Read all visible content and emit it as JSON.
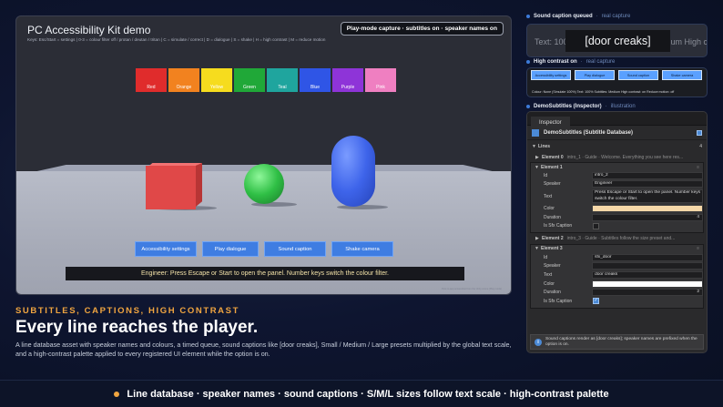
{
  "game": {
    "title": "PC Accessibility Kit demo",
    "keys_hint": "Keys: Esc/Start = settings  |  0-3 = colour filter off / protan / deutan / tritan  |  C = simulate / correct  |  D = dialogue  |  S = shake  |  H = high contrast  |  M = reduce motion",
    "badge": "Play-mode capture · subtitles on · speaker names on",
    "swatches": [
      {
        "label": "Red",
        "color": "#e02c2c"
      },
      {
        "label": "Orange",
        "color": "#f2821f"
      },
      {
        "label": "Yellow",
        "color": "#f6dc1e"
      },
      {
        "label": "Green",
        "color": "#20a838"
      },
      {
        "label": "Teal",
        "color": "#1fa59e"
      },
      {
        "label": "Blue",
        "color": "#2f55e6"
      },
      {
        "label": "Purple",
        "color": "#8e34d8"
      },
      {
        "label": "Pink",
        "color": "#ef7fc1"
      }
    ],
    "buttons": [
      "Accessibility settings",
      "Play dialogue",
      "Sound caption",
      "Shake camera"
    ],
    "subtitle": "Engineer: Press Escape or Start to open the panel. Number keys switch the colour filter.",
    "watermark": "Pure in-app screenshot from the Unity scene (Play mode)"
  },
  "copy": {
    "kicker": "SUBTITLES, CAPTIONS, HIGH CONTRAST",
    "headline": "Every line reaches the player.",
    "description": "A line database asset with speaker names and colours, a timed queue, sound captions like [door creaks], Small / Medium / Large presets multiplied by the global text scale, and a high-contrast palette applied to every registered UI element while the option is on."
  },
  "footer": {
    "text": "Line database · speaker names · sound captions · S/M/L sizes follow text scale · high-contrast palette"
  },
  "caption_panel": {
    "label": "Sound caption queued",
    "sublabel": "real capture",
    "caption": "[door creaks]",
    "ghost_left": "Text: 100%",
    "ghost_right": "um  High co"
  },
  "hc_panel": {
    "label": "High contrast on",
    "sublabel": "real capture",
    "buttons": [
      "Accessibility settings",
      "Play dialogue",
      "Sound caption",
      "Shake camera"
    ],
    "status": "Colour: None (Simulate 100%)  Text: 100%  Subtitles: Medium  High contrast: on  Reduce motion: off"
  },
  "inspector": {
    "label": "DemoSubtitles (Inspector)",
    "sublabel": "illustration",
    "tab": "Inspector",
    "asset_title": "DemoSubtitles (Subtitle Database)",
    "lines_label": "Lines",
    "lines_count": "4",
    "element0": {
      "label": "Element 0",
      "summary": "intro_1 · Guide · Welcome. Everything you see here res..."
    },
    "element1": {
      "label": "Element 1",
      "id_label": "Id",
      "id": "intro_2",
      "speaker_label": "Speaker",
      "speaker": "Engineer",
      "text_label": "Text",
      "text": "Press Escape or Start to open the panel. Number keys switch the colour filter.",
      "color_label": "Color",
      "color": "#f6d8a8",
      "duration_label": "Duration",
      "duration": "4",
      "sfx_label": "Is Sfx Caption"
    },
    "element2": {
      "label": "Element 2",
      "summary": "intro_3 · Guide · Subtitles follow the size preset and..."
    },
    "element3": {
      "label": "Element 3",
      "id_label": "Id",
      "id": "sfx_door",
      "speaker_label": "Speaker",
      "speaker": "",
      "text_label": "Text",
      "text": "door creaks",
      "color_label": "Color",
      "color": "#ffffff",
      "duration_label": "Duration",
      "duration": "2",
      "sfx_label": "Is Sfx Caption"
    },
    "info": "Sound captions render as [door creaks]; speaker names are prefixed when the option is on."
  }
}
